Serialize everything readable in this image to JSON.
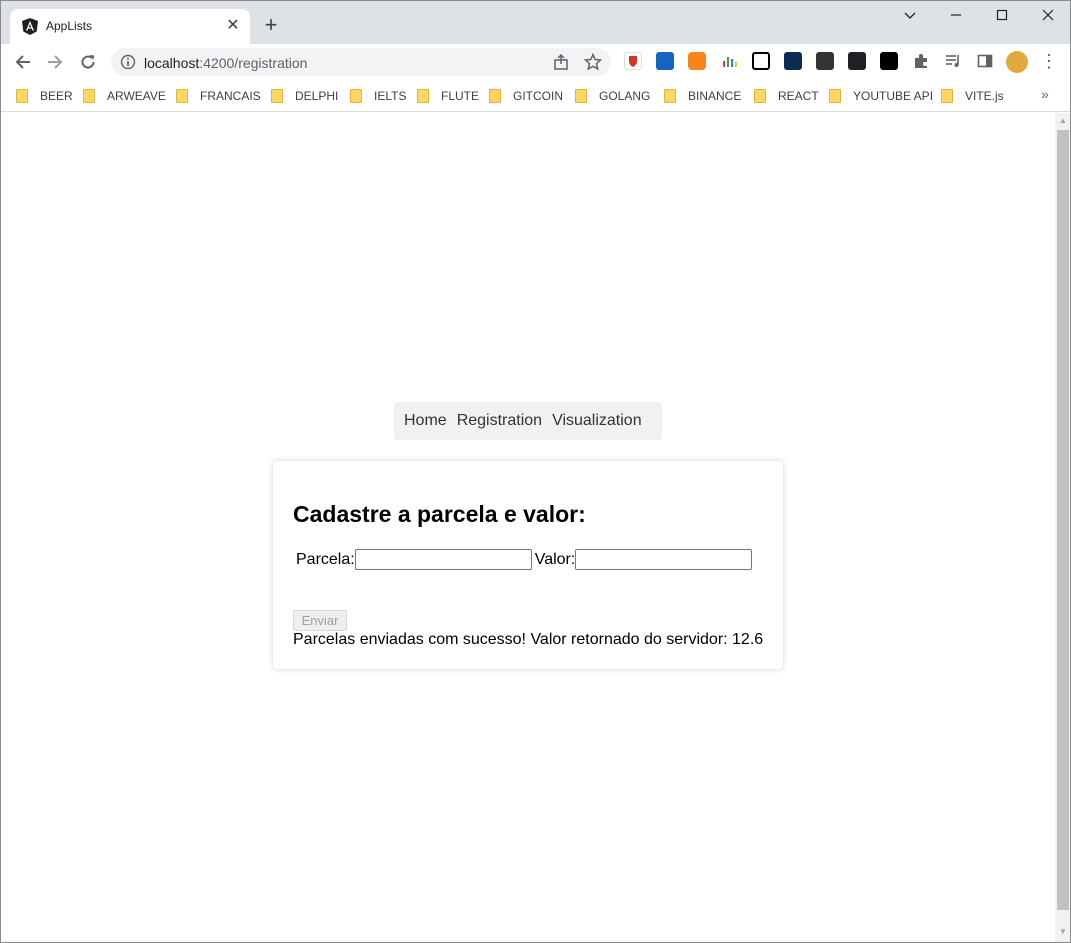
{
  "browser": {
    "tab_title": "AppLists",
    "url_host": "localhost",
    "url_port_path": ":4200/registration",
    "bookmarks": [
      "BEER",
      "ARWEAVE",
      "FRANCAIS",
      "DELPHI",
      "IELTS",
      "FLUTE",
      "GITCOIN",
      "GOLANG",
      "BINANCE",
      "REACT",
      "YOUTUBE API",
      "VITE.js"
    ],
    "bookmarks_more": "»"
  },
  "nav": {
    "home": "Home",
    "registration": "Registration",
    "visualization": "Visualization"
  },
  "form": {
    "heading": "Cadastre a parcela e valor:",
    "parcela_label": "Parcela:",
    "valor_label": "Valor:",
    "parcela_value": "",
    "valor_value": "",
    "submit_label": "Enviar",
    "status_message": "Parcelas enviadas com sucesso! Valor retornado do servidor: 12.6"
  },
  "colors": {
    "tabstrip": "#dee1e6",
    "omnibox": "#f1f3f4",
    "navbar": "#f1f1f1"
  }
}
